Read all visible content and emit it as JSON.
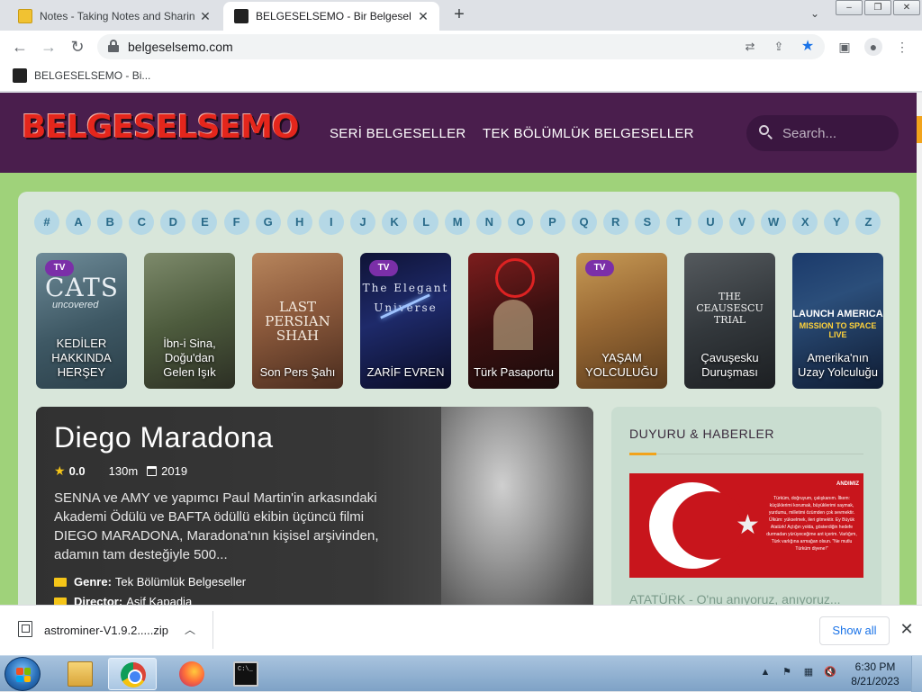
{
  "browser": {
    "tabs": [
      {
        "title": "Notes - Taking Notes and Sharing",
        "close": "✕"
      },
      {
        "title": "BELGESELSEMO - Bir Belgesel Ha",
        "close": "✕"
      }
    ],
    "new_tab": "+",
    "url": "belgeselsemo.com",
    "bookmark": "BELGESELSEMO - Bi..."
  },
  "site": {
    "logo": "BELGESELSEMO",
    "nav": [
      "SERİ BELGESELLER",
      "TEK BÖLÜMLÜK BELGESELLER"
    ],
    "search_placeholder": "Search..."
  },
  "letters": [
    "#",
    "A",
    "B",
    "C",
    "D",
    "E",
    "F",
    "G",
    "H",
    "I",
    "J",
    "K",
    "L",
    "M",
    "N",
    "O",
    "P",
    "Q",
    "R",
    "S",
    "T",
    "U",
    "V",
    "W",
    "X",
    "Y",
    "Z"
  ],
  "cards": [
    {
      "title": "KEDİLER HAKKINDA HERŞEY",
      "badge": "TV",
      "art": "CATS",
      "art2": "uncovered"
    },
    {
      "title": "İbn-i Sina, Doğu'dan Gelen Işık",
      "badge": "",
      "art": "",
      "art2": ""
    },
    {
      "title": "Son Pers Şahı",
      "badge": "",
      "art": "LAST PERSIAN SHAH",
      "art2": ""
    },
    {
      "title": "ZARİF EVREN",
      "badge": "TV",
      "art": "The Elegant Universe",
      "art2": ""
    },
    {
      "title": "Türk Pasaportu",
      "badge": "",
      "art": "",
      "art2": ""
    },
    {
      "title": "YAŞAM YOLCULUĞU",
      "badge": "TV",
      "art": "",
      "art2": ""
    },
    {
      "title": "Çavuşesku Duruşması",
      "badge": "",
      "art": "THE CEAUSESCU TRIAL",
      "art2": ""
    },
    {
      "title": "Amerika'nın Uzay Yolculuğu",
      "badge": "",
      "art": "LAUNCH AMERICA",
      "art2": "MISSION TO SPACE LIVE"
    }
  ],
  "featured": {
    "title": "Diego Maradona",
    "rating": "0.0",
    "duration": "130m",
    "year": "2019",
    "description": "SENNA ve AMY ve yapımcı Paul Martin'in arkasındaki Akademi Ödülü ve BAFTA ödüllü ekibin üçüncü filmi DIEGO MARADONA, Maradona'nın kişisel arşivinden, adamın tam desteğiyle 500...",
    "genre_label": "Genre:",
    "genre": "Tek Bölümlük Belgeseller",
    "director_label": "Director:",
    "director": "Asif Kapadia"
  },
  "sidebar": {
    "heading": "DUYURU & HABERLER",
    "image_title": "ANDIMIZ",
    "image_text": "Türküm, doğruyum, çalışkanım. İlkem: küçüklerimi korumak, büyüklerimi saymak, yurdumu, milletimi özümden çok sevmektir. Ülküm: yükselmek, ileri gitmektir. Ey Büyük Atatürk! Açtığın yolda, gösterdiğin hedefe durmadan yürüyeceğime ant içerim. Varlığım, Türk varlığına armağan olsun. \"Ne mutlu Türküm diyene!\"",
    "news_title": "ATATÜRK - O'nu anıyoruz, anıyoruz..."
  },
  "download": {
    "filename": "astrominer-V1.9.2.....zip",
    "show_all": "Show all"
  },
  "taskbar": {
    "time": "6:30 PM",
    "date": "8/21/2023"
  },
  "colors": {
    "header_bg": "#4a1e4d",
    "page_bg": "#9fd27a",
    "accent": "#f2a31b",
    "badge": "#7b2fa8"
  }
}
